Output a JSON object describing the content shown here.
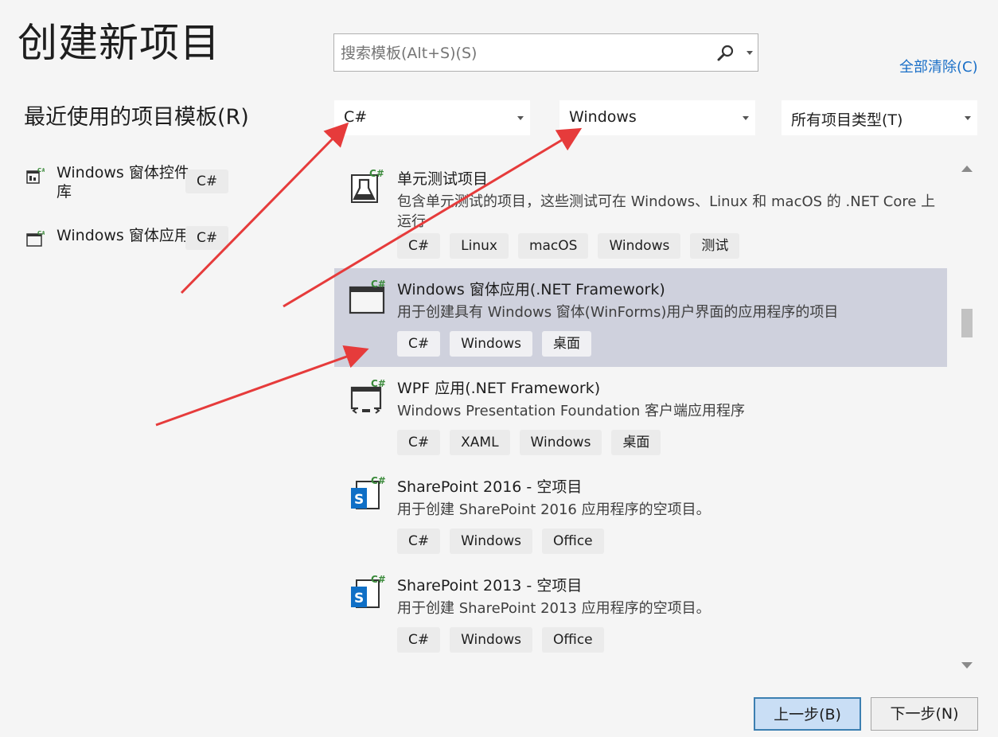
{
  "page": {
    "title": "创建新项目",
    "recent_title": "最近使用的项目模板(R)",
    "clear_all": "全部清除(C)"
  },
  "search": {
    "placeholder": "搜索模板(Alt+S)(S)"
  },
  "filters": {
    "language": "C#",
    "platform": "Windows",
    "project_type": "所有项目类型(T)"
  },
  "recent": [
    {
      "name": "Windows 窗体控件库",
      "tag": "C#"
    },
    {
      "name": "Windows 窗体应用",
      "tag": "C#"
    }
  ],
  "templates": [
    {
      "title": "单元测试项目",
      "description": "包含单元测试的项目，这些测试可在 Windows、Linux 和 macOS 的 .NET Core 上运行",
      "tags": [
        "C#",
        "Linux",
        "macOS",
        "Windows",
        "测试"
      ],
      "icon": "unit-test-icon"
    },
    {
      "title": "Windows 窗体应用(.NET Framework)",
      "description": "用于创建具有 Windows 窗体(WinForms)用户界面的应用程序的项目",
      "tags": [
        "C#",
        "Windows",
        "桌面"
      ],
      "icon": "winforms-icon"
    },
    {
      "title": "WPF 应用(.NET Framework)",
      "description": "Windows Presentation Foundation 客户端应用程序",
      "tags": [
        "C#",
        "XAML",
        "Windows",
        "桌面"
      ],
      "icon": "wpf-icon"
    },
    {
      "title": "SharePoint 2016 - 空项目",
      "description": "用于创建 SharePoint 2016 应用程序的空项目。",
      "tags": [
        "C#",
        "Windows",
        "Office"
      ],
      "icon": "sharepoint-icon"
    },
    {
      "title": "SharePoint 2013 - 空项目",
      "description": "用于创建 SharePoint 2013 应用程序的空项目。",
      "tags": [
        "C#",
        "Windows",
        "Office"
      ],
      "icon": "sharepoint-icon"
    }
  ],
  "selected_template_index": 1,
  "buttons": {
    "back": "上一步(B)",
    "next": "下一步(N)"
  },
  "colors": {
    "accent_link": "#1a6fc7",
    "selection": "#cfd1dd",
    "csharp_badge": "#3a8a3a",
    "annotation_arrow": "#e63b3b",
    "sharepoint_blue": "#0f6fc6"
  }
}
